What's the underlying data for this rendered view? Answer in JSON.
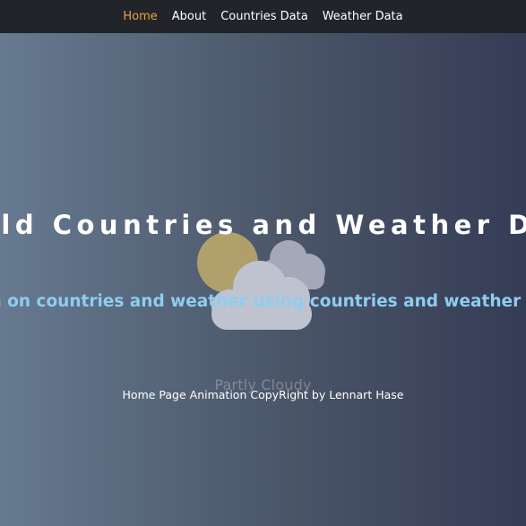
{
  "navbar": {
    "items": [
      {
        "label": "Home",
        "active": true
      },
      {
        "label": "About",
        "active": false
      },
      {
        "label": "Countries Data",
        "active": false
      },
      {
        "label": "Weather Data",
        "active": false
      }
    ],
    "active_color": "#f0a04b"
  },
  "hero": {
    "title": "World Countries and Weather Data",
    "subtitle": "Data on countries and weather using countries and weather APIs",
    "subtitle_color": "#8ecdf0"
  },
  "animation": {
    "icon": "partly-cloudy-icon",
    "caption": "Partly Cloudy"
  },
  "footer": {
    "credit": "Home Page Animation CopyRight by Lennart Hase"
  }
}
